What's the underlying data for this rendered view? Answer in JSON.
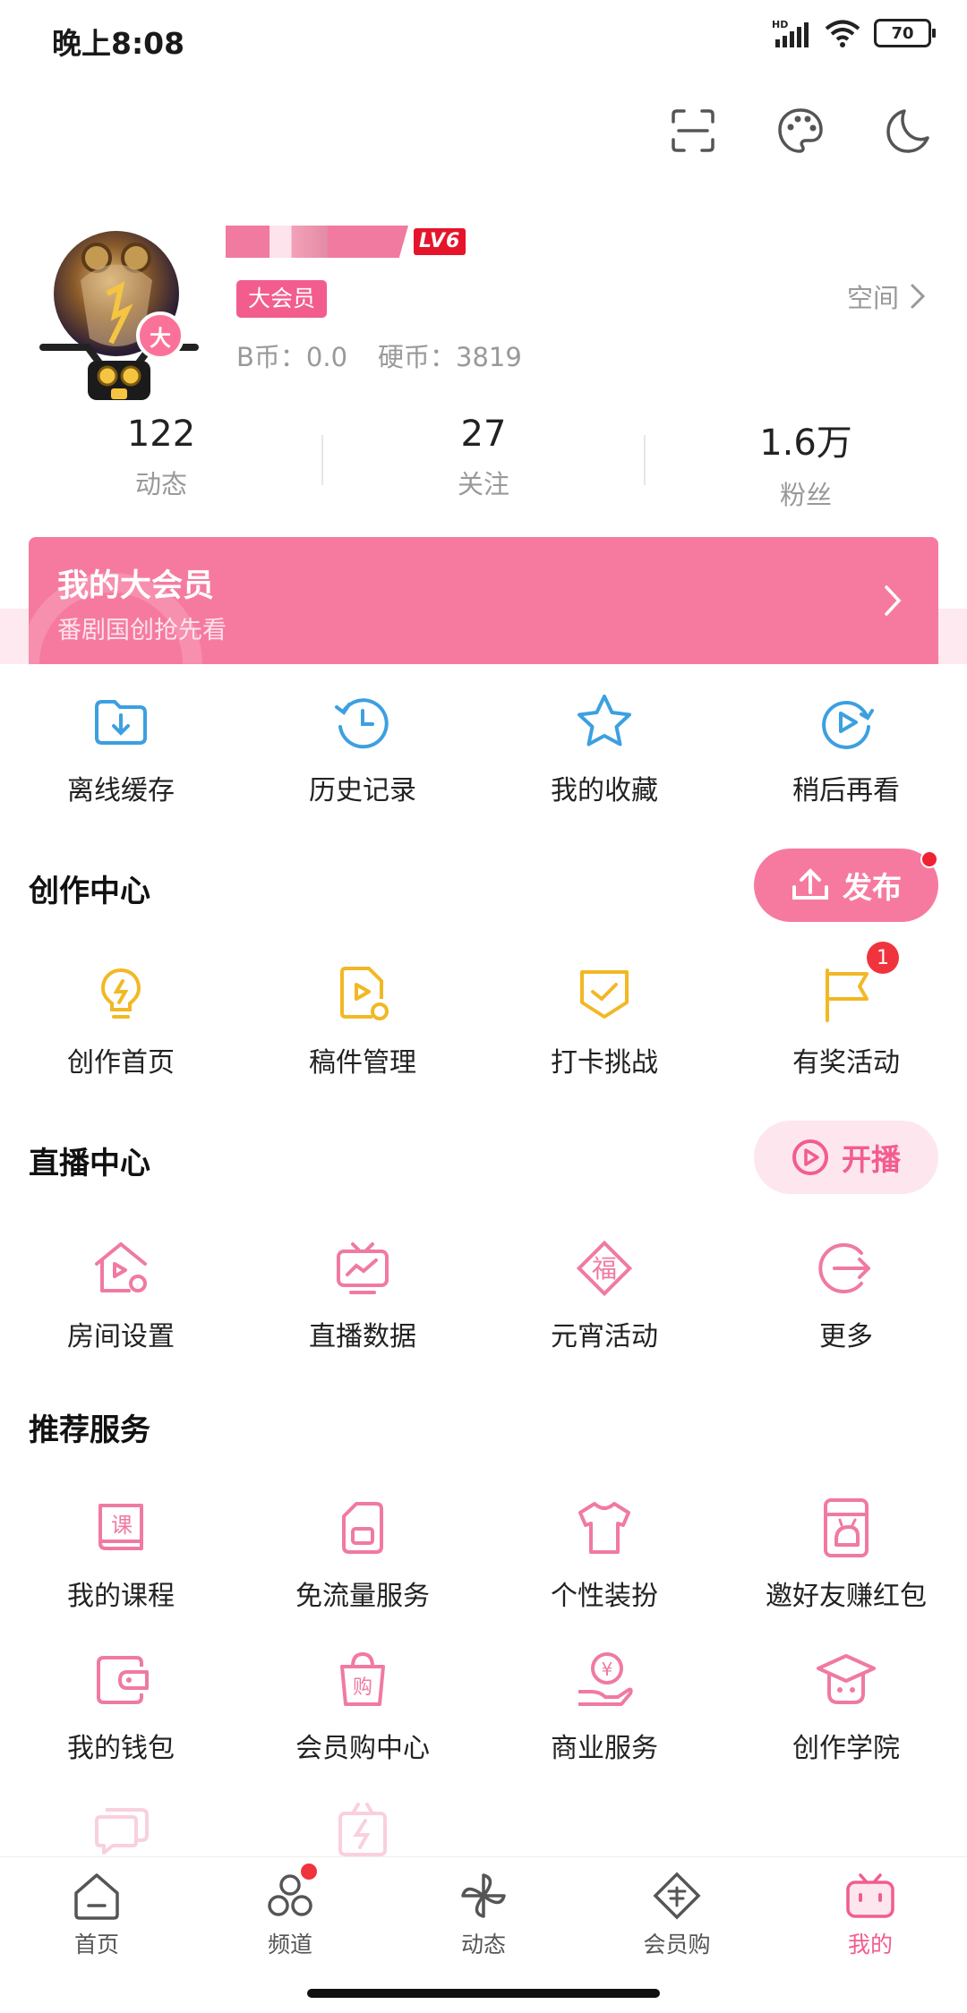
{
  "status_bar": {
    "time": "晚上8:08",
    "network": "HD",
    "battery": "70"
  },
  "profile": {
    "level": "LV6",
    "vip_tag": "大会员",
    "avatar_badge": "大",
    "b_coin": "B币：0.0",
    "hard_coin": "硬币：3819",
    "space_label": "空间"
  },
  "stats": [
    {
      "value": "122",
      "label": "动态"
    },
    {
      "value": "27",
      "label": "关注"
    },
    {
      "value": "1.6万",
      "label": "粉丝"
    }
  ],
  "vip_banner": {
    "title": "我的大会员",
    "subtitle": "番剧国创抢先看"
  },
  "quick_actions": [
    {
      "label": "离线缓存",
      "icon": "download-folder-icon"
    },
    {
      "label": "历史记录",
      "icon": "history-clock-icon"
    },
    {
      "label": "我的收藏",
      "icon": "star-icon"
    },
    {
      "label": "稍后再看",
      "icon": "watch-later-icon"
    }
  ],
  "creation_center": {
    "title": "创作中心",
    "publish_label": "发布",
    "items": [
      {
        "label": "创作首页",
        "icon": "lightbulb-icon"
      },
      {
        "label": "稿件管理",
        "icon": "manuscript-icon"
      },
      {
        "label": "打卡挑战",
        "icon": "checkin-icon"
      },
      {
        "label": "有奖活动",
        "icon": "flag-icon",
        "badge": "1"
      }
    ]
  },
  "live_center": {
    "title": "直播中心",
    "start_label": "开播",
    "items": [
      {
        "label": "房间设置",
        "icon": "room-settings-icon"
      },
      {
        "label": "直播数据",
        "icon": "live-data-icon"
      },
      {
        "label": "元宵活动",
        "icon": "fu-icon",
        "glyph": "福"
      },
      {
        "label": "更多",
        "icon": "more-arrow-icon"
      }
    ]
  },
  "recommended": {
    "title": "推荐服务",
    "items": [
      {
        "label": "我的课程",
        "icon": "course-icon",
        "glyph": "课"
      },
      {
        "label": "免流量服务",
        "icon": "sim-card-icon"
      },
      {
        "label": "个性装扮",
        "icon": "tshirt-icon"
      },
      {
        "label": "邀好友赚红包",
        "icon": "invite-icon"
      },
      {
        "label": "我的钱包",
        "icon": "wallet-icon"
      },
      {
        "label": "会员购中心",
        "icon": "shopping-bag-icon",
        "glyph": "购"
      },
      {
        "label": "商业服务",
        "icon": "business-icon",
        "glyph": "¥"
      },
      {
        "label": "创作学院",
        "icon": "academy-icon"
      }
    ]
  },
  "colors": {
    "accent": "#f25d8e",
    "banner": "#f67aa0",
    "blue": "#3ca0e0",
    "gold": "#f2b824"
  },
  "bottom_nav": [
    {
      "label": "首页",
      "icon": "home-icon"
    },
    {
      "label": "频道",
      "icon": "channel-icon"
    },
    {
      "label": "动态",
      "icon": "pinwheel-icon"
    },
    {
      "label": "会员购",
      "icon": "mall-icon"
    },
    {
      "label": "我的",
      "icon": "tv-mine-icon",
      "active": true
    }
  ]
}
